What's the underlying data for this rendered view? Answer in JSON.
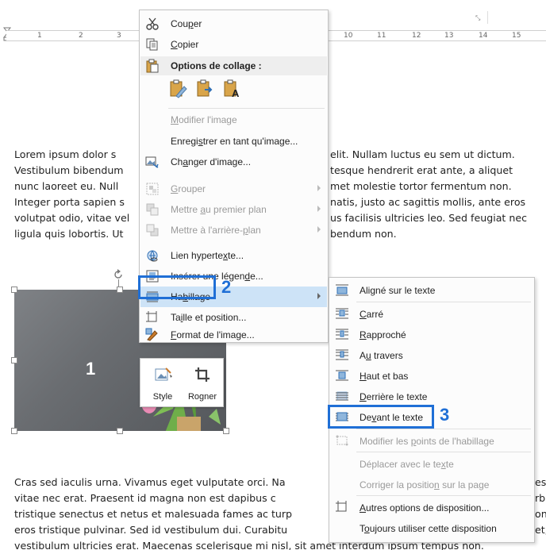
{
  "ruler": {
    "numbers": [
      "1",
      "2",
      "3",
      "10",
      "11",
      "12",
      "13",
      "14",
      "15"
    ],
    "launcher_glyph": "⤡"
  },
  "document": {
    "paragraph1_lines": [
      "Lorem ipsum dolor s",
      "Vestibulum bibendum",
      "nunc laoreet eu. Null",
      "Integer porta sapien s",
      "volutpat odio, vitae vel",
      "ligula quis lobortis. Ut"
    ],
    "paragraph1_right_lines": [
      "elit. Nullam luctus eu sem ut dictum.",
      "tesque hendrerit erat ante, a aliquet",
      "met molestie tortor fermentum non.",
      "natis, justo ac sagittis mollis, ante eros",
      "us facilisis ultricies leo. Sed feugiat nec",
      "bendum non."
    ],
    "paragraph2_lines": [
      "Cras sed iaculis urna. Vivamus eget vulputate orci. Na",
      "vitae nec erat. Praesent id magna non est dapibus c",
      "tristique senectus et netus et malesuada fames ac turp",
      "eros tristique pulvinar. Sed id vestibulum dui. Curabitu",
      "vestibulum ultricies erat. Maecenas scelerisque mi nisl, sit amet interdum ipsum tempus non."
    ],
    "paragraph2_right_lines": [
      "es",
      "rbi",
      "on",
      "et,"
    ]
  },
  "callouts": {
    "picture": "1",
    "wrap_item": "2",
    "front_of_text": "3"
  },
  "mini_toolbar": {
    "style_label": "Style",
    "crop_label": "Rogner"
  },
  "context_menu": {
    "items": {
      "cut": {
        "pre": "Cou",
        "ul": "p",
        "post": "er"
      },
      "copy": {
        "pre": "",
        "ul": "C",
        "post": "opier"
      },
      "paste_header": "Options de collage :",
      "edit_image": {
        "pre": "",
        "ul": "M",
        "post": "odifier l'image"
      },
      "save_as_image": {
        "pre": "Enregi",
        "ul": "s",
        "post": "trer en tant qu'image..."
      },
      "change_image": {
        "pre": "Ch",
        "ul": "a",
        "post": "nger d'image..."
      },
      "group": {
        "pre": "",
        "ul": "G",
        "post": "rouper"
      },
      "bring_front": {
        "pre": "Mettre ",
        "ul": "a",
        "post": "u premier plan"
      },
      "send_back": {
        "pre": "Mettre à l'arrière-",
        "ul": "p",
        "post": "lan"
      },
      "hyperlink": {
        "pre": "Lien hyperte",
        "ul": "x",
        "post": "te..."
      },
      "insert_caption": {
        "pre": "Insérer une légen",
        "ul": "d",
        "post": "e..."
      },
      "wrap_text": {
        "pre": "Ha",
        "ul": "b",
        "post": "illage"
      },
      "size_position": {
        "pre": "Ta",
        "ul": "i",
        "post": "lle et position..."
      },
      "format_image": {
        "pre": "",
        "ul": "F",
        "post": "ormat de l'image..."
      }
    }
  },
  "wrap_submenu": {
    "items": {
      "inline": {
        "pre": "Ali",
        "ul": "g",
        "post": "né sur le texte"
      },
      "square": {
        "pre": "",
        "ul": "C",
        "post": "arré"
      },
      "tight": {
        "pre": "",
        "ul": "R",
        "post": "approché"
      },
      "through": {
        "pre": "A",
        "ul": "u",
        "post": " travers"
      },
      "top_bottom": {
        "pre": "",
        "ul": "H",
        "post": "aut et bas"
      },
      "behind": {
        "pre": "",
        "ul": "D",
        "post": "errière le texte"
      },
      "in_front": {
        "pre": "De",
        "ul": "v",
        "post": "ant le texte"
      },
      "edit_points": {
        "pre": "Modifier les ",
        "ul": "p",
        "post": "oints de l'habillage"
      },
      "move_with_text": {
        "pre": "Déplacer avec le te",
        "ul": "x",
        "post": "te"
      },
      "fix_position": {
        "pre": "Corriger la positio",
        "ul": "n",
        "post": " sur la page"
      },
      "more_layout": {
        "pre": "",
        "ul": "A",
        "post": "utres options de disposition..."
      },
      "default_layout": {
        "pre": "T",
        "ul": "o",
        "post": "ujours utiliser cette disposition"
      }
    }
  },
  "colors": {
    "accent_blue": "#1f6fd6",
    "highlight": "#cde3f7",
    "disabled_text": "#9a9a9a"
  }
}
